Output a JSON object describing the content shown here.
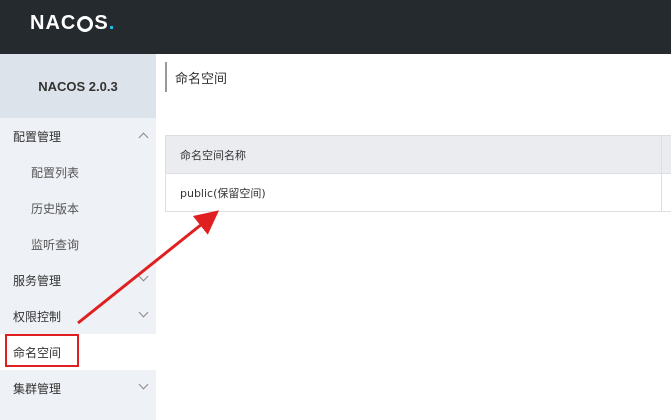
{
  "header": {
    "logo_prefix": "NAC",
    "logo_suffix": "S",
    "logo_dot": "."
  },
  "sidebar": {
    "version": "NACOS 2.0.3",
    "items": [
      {
        "label": "配置管理"
      },
      {
        "label": "配置列表"
      },
      {
        "label": "历史版本"
      },
      {
        "label": "监听查询"
      },
      {
        "label": "服务管理"
      },
      {
        "label": "权限控制"
      },
      {
        "label": "命名空间"
      },
      {
        "label": "集群管理"
      }
    ]
  },
  "main": {
    "title": "命名空间",
    "table": {
      "header": "命名空间名称",
      "rows": [
        {
          "name": "public(保留空间)"
        }
      ]
    }
  },
  "annotation": {
    "color": "#e02020"
  }
}
